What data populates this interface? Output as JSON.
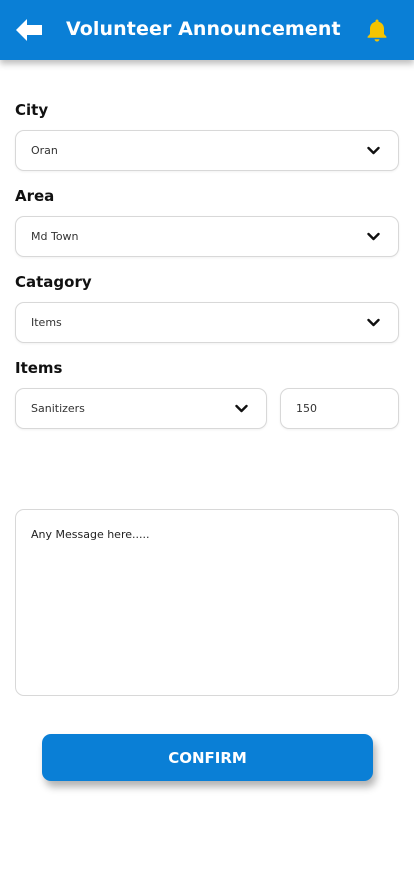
{
  "header": {
    "title": "Volunteer Announcement",
    "back_icon": "arrow-left-icon",
    "notification_icon": "bell-icon",
    "bg_color": "#0a7fd6",
    "bell_color": "#f5c400"
  },
  "form": {
    "city": {
      "label": "City",
      "value": "Oran"
    },
    "area": {
      "label": "Area",
      "value": "Md Town"
    },
    "category": {
      "label": "Catagory",
      "value": "Items"
    },
    "items": {
      "label": "Items",
      "value": "Sanitizers",
      "quantity": "150"
    },
    "message": {
      "placeholder": "Any Message here....."
    }
  },
  "actions": {
    "confirm_label": "CONFIRM"
  }
}
